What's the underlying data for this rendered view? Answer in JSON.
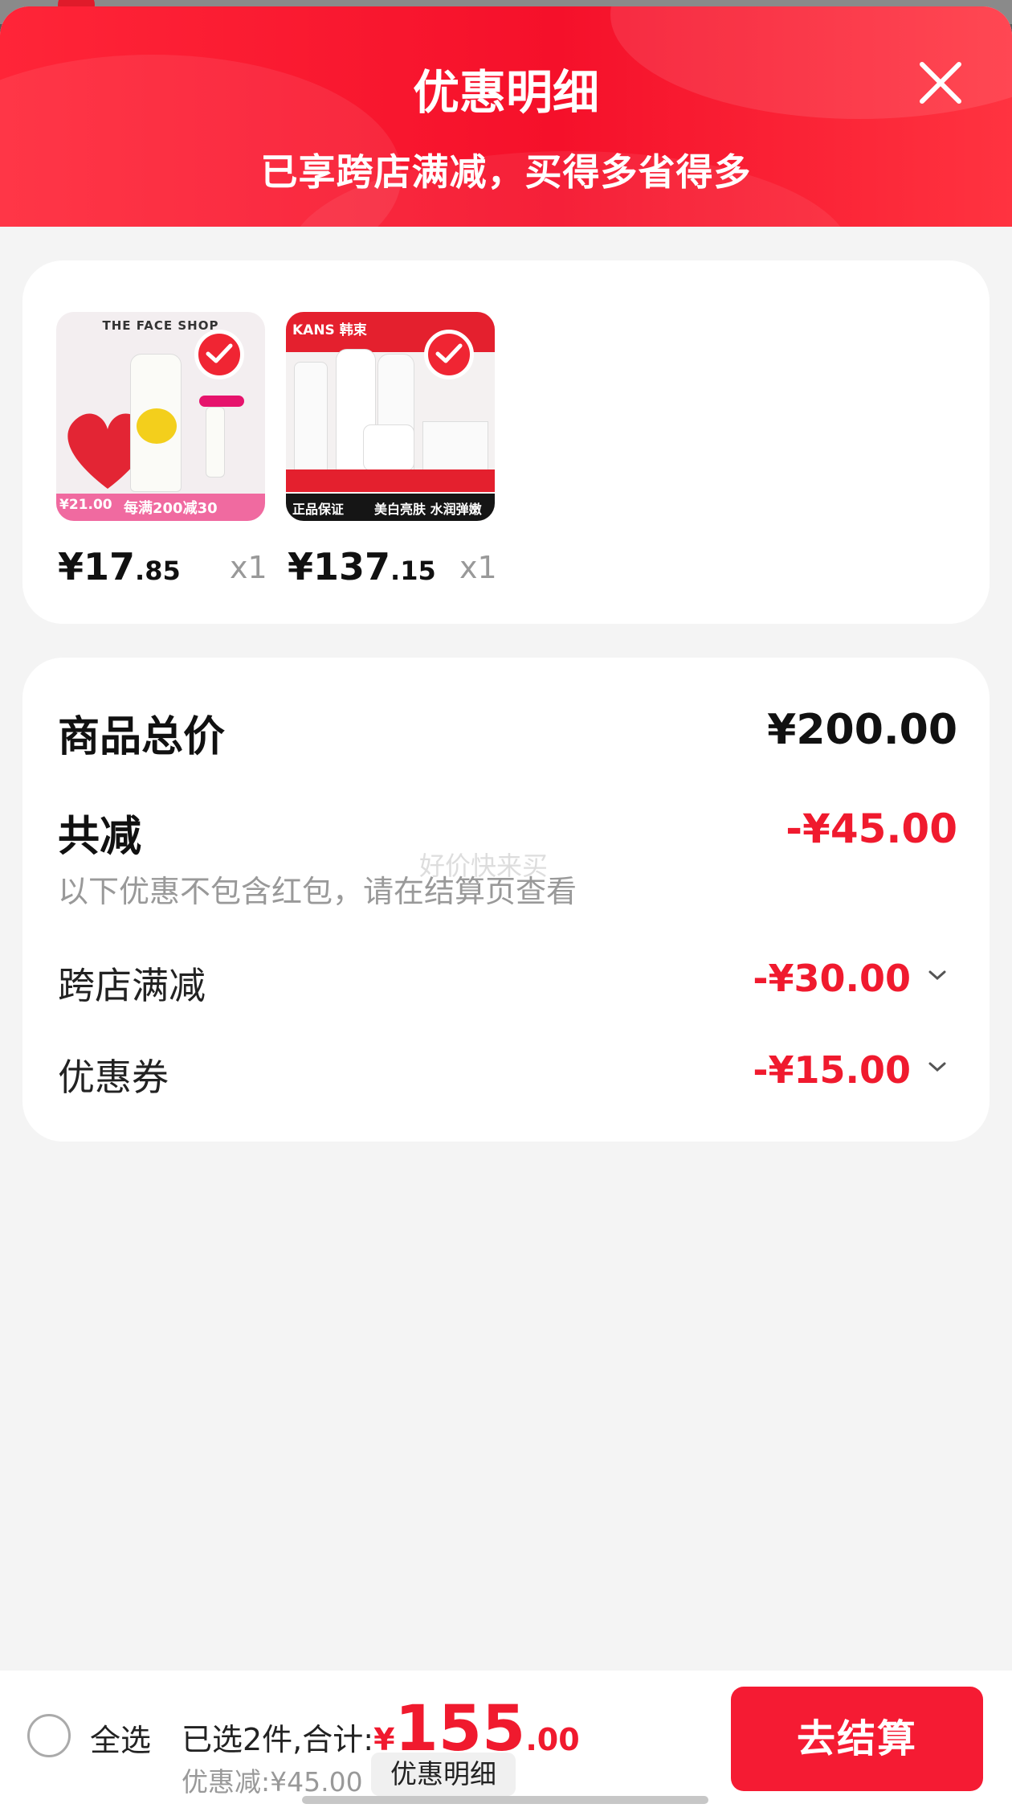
{
  "header": {
    "title": "优惠明细",
    "subtitle": "已享跨店满减，买得多省得多",
    "close_icon": "close-icon"
  },
  "products": [
    {
      "brand": "THE FACE SHOP",
      "promo_price": "¥21.00",
      "promo_text": "每满200减30",
      "price_main": "¥17",
      "price_cents": ".85",
      "qty": "x1",
      "selected": true
    },
    {
      "brand": "KANS 韩束",
      "promo_left": "正品保证",
      "promo_right": "美白亮肤 水润弹嫩",
      "price_main": "¥137",
      "price_cents": ".15",
      "qty": "x1",
      "selected": true
    }
  ],
  "summary": {
    "total_label": "商品总价",
    "total_value": "¥200.00",
    "reduce_label": "共减",
    "reduce_value": "-¥45.00",
    "note": "以下优惠不包含红包，请在结算页查看",
    "watermark": "好价快来买",
    "items": [
      {
        "label": "跨店满减",
        "value": "-¥30.00"
      },
      {
        "label": "优惠券",
        "value": "-¥15.00"
      }
    ]
  },
  "footer": {
    "select_all": "全选",
    "selected_text": "已选2件,合计:",
    "currency": "¥",
    "total_int": "155",
    "total_dec": ".00",
    "saved": "优惠减:¥45.00",
    "detail_button": "优惠明细",
    "checkout_button": "去结算"
  },
  "colors": {
    "accent": "#f01a2e",
    "header_red": "#f5102a"
  }
}
